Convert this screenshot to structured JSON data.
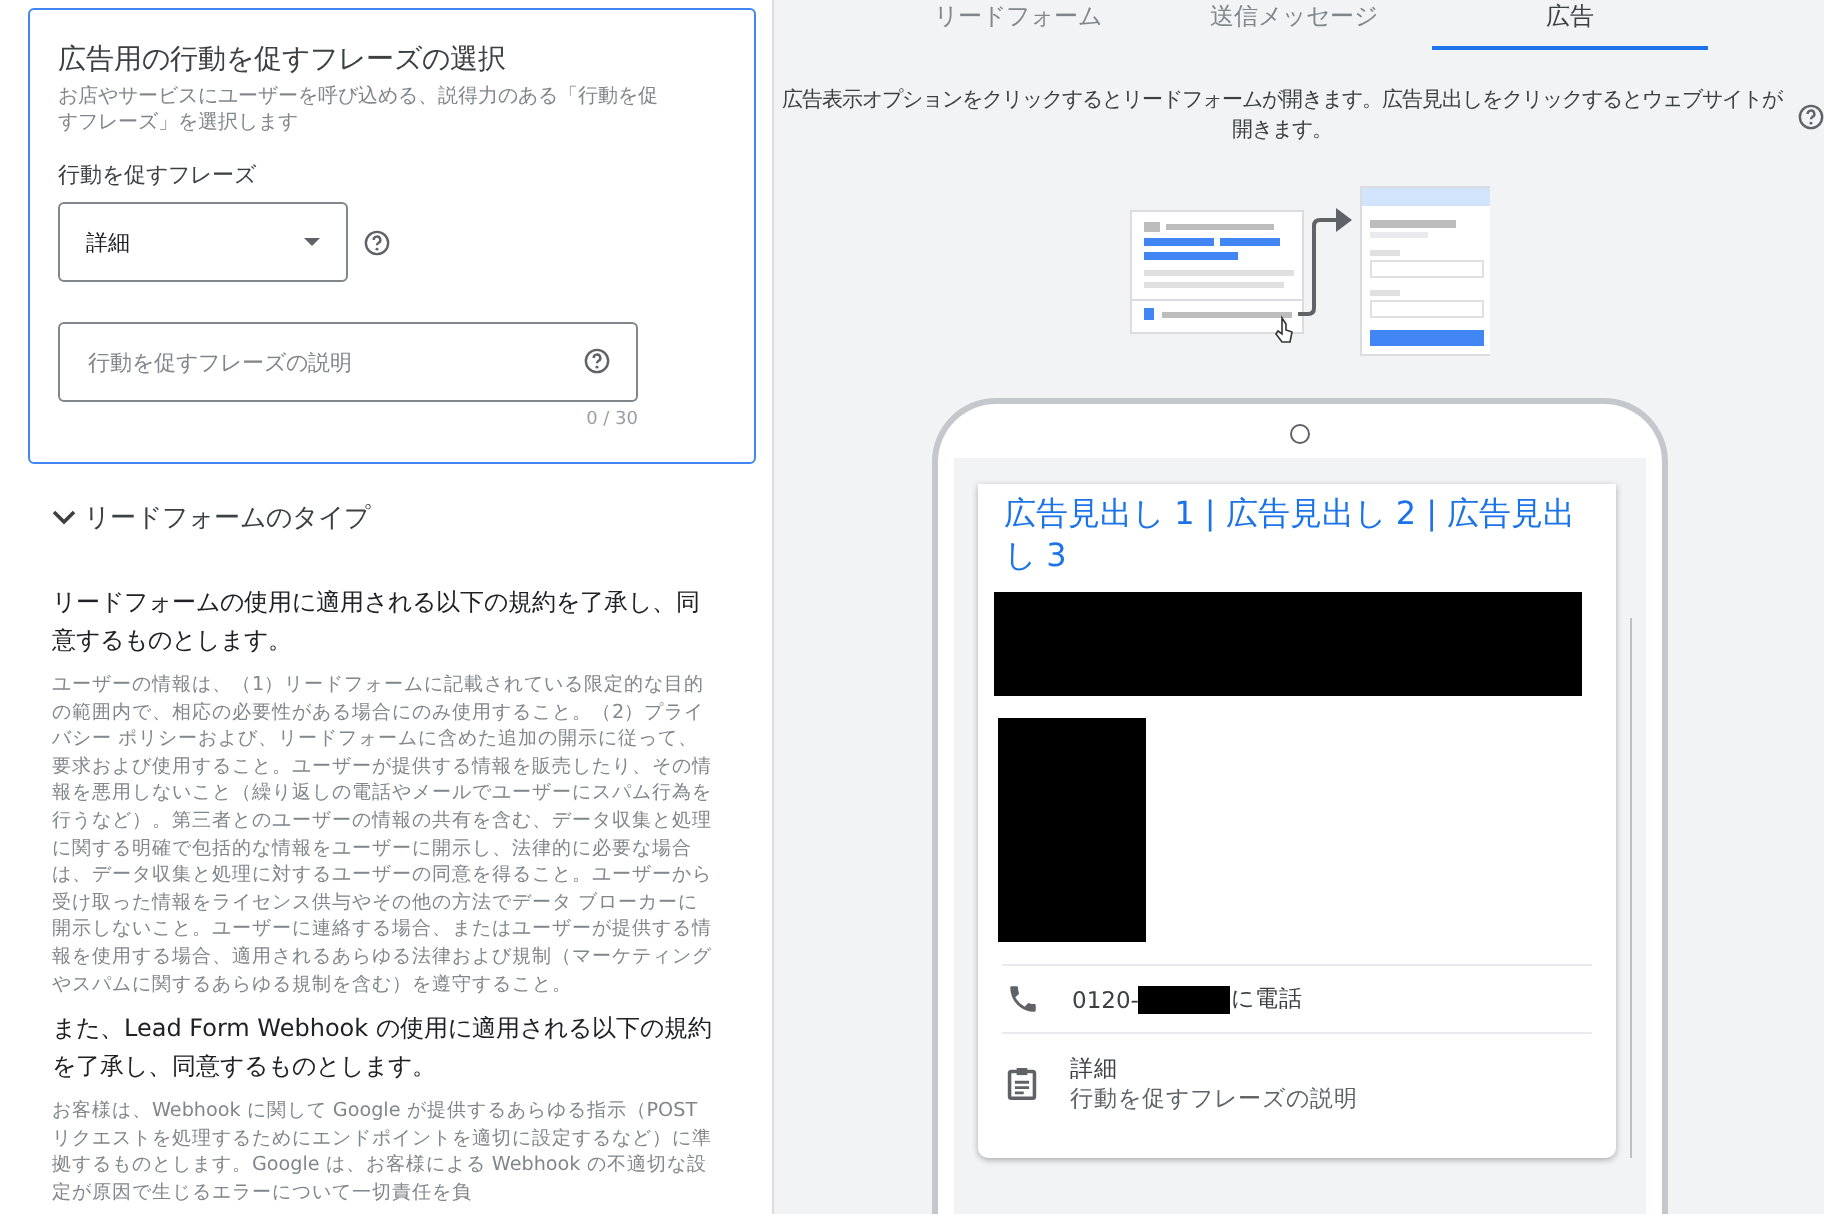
{
  "cta_card": {
    "title": "広告用の行動を促すフレーズの選択",
    "description": "お店やサービスにユーザーを呼び込める、説得力のある「行動を促すフレーズ」を選択します",
    "select_label": "行動を促すフレーズ",
    "select_value": "詳細",
    "text_field": {
      "placeholder": "行動を促すフレーズの説明",
      "counter": "0 / 30"
    }
  },
  "section": {
    "title": "リードフォームのタイプ",
    "expanded": true
  },
  "terms": [
    {
      "heading": "リードフォームの使用に適用される以下の規約を了承し、同意するものとします。",
      "body": "ユーザーの情報は、（1）リードフォームに記載されている限定的な目的の範囲内で、相応の必要性がある場合にのみ使用すること。（2）プライバシー ポリシーおよび、リードフォームに含めた追加の開示に従って、要求および使用すること。ユーザーが提供する情報を販売したり、その情報を悪用しないこと（繰り返しの電話やメールでユーザーにスパム行為を行うなど）。第三者とのユーザーの情報の共有を含む、データ収集と処理に関する明確で包括的な情報をユーザーに開示し、法律的に必要な場合は、データ収集と処理に対するユーザーの同意を得ること。ユーザーから受け取った情報をライセンス供与やその他の方法でデータ ブローカーに開示しないこと。ユーザーに連絡する場合、またはユーザーが提供する情報を使用する場合、適用されるあらゆる法律および規制（マーケティングやスパムに関するあらゆる規制を含む）を遵守すること。"
    },
    {
      "heading": "また、Lead Form Webhook の使用に適用される以下の規約を了承し、同意するものとします。",
      "body": "お客様は、Webhook に関して Google が提供するあらゆる指示（POST リクエストを処理するためにエンドポイントを適切に設定するなど）に準拠するものとします。Google は、お客様による Webhook の不適切な設定が原因で生じるエラーについて一切責任を負"
    }
  ],
  "tabs": [
    {
      "label": "リードフォーム",
      "selected": false
    },
    {
      "label": "送信メッセージ",
      "selected": false
    },
    {
      "label": "広告",
      "selected": true
    }
  ],
  "preview_note": "広告表示オプションをクリックするとリードフォームが開きます。広告見出しをクリックするとウェブサイトが開きます。",
  "ad_preview": {
    "headline": "広告見出し 1 | 広告見出し 2 | 広告見出し 3",
    "phone_prefix": "0120-",
    "phone_suffix": "に電話",
    "extension_title": "詳細",
    "extension_description": "行動を促すフレーズの説明"
  }
}
